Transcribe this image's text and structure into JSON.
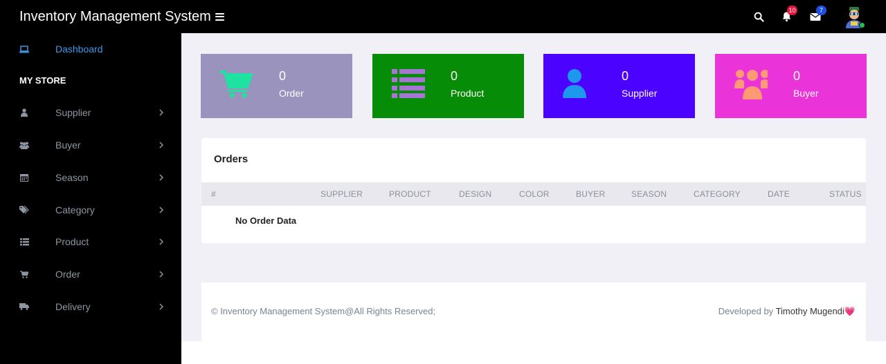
{
  "app": {
    "title": "Inventory Management System"
  },
  "topbar": {
    "notifications_count": "10",
    "messages_count": "7"
  },
  "sidebar": {
    "dashboard": "Dashboard",
    "section": "MY STORE",
    "items": [
      {
        "label": "Supplier",
        "icon": "user-icon"
      },
      {
        "label": "Buyer",
        "icon": "users-icon"
      },
      {
        "label": "Season",
        "icon": "calendar-icon"
      },
      {
        "label": "Category",
        "icon": "tags-icon"
      },
      {
        "label": "Product",
        "icon": "list-icon"
      },
      {
        "label": "Order",
        "icon": "cart-icon"
      },
      {
        "label": "Delivery",
        "icon": "truck-icon"
      }
    ]
  },
  "cards": [
    {
      "count": "0",
      "label": "Order",
      "color": "#9a93bd",
      "icon_color": "#1ee3a0"
    },
    {
      "count": "0",
      "label": "Product",
      "color": "#068c06",
      "icon_color": "#a874d6"
    },
    {
      "count": "0",
      "label": "Supplier",
      "color": "#4c02ff",
      "icon_color": "#1e97ee"
    },
    {
      "count": "0",
      "label": "Buyer",
      "color": "#ea33d9",
      "icon_color": "#fd9a74"
    }
  ],
  "orders": {
    "title": "Orders",
    "columns": [
      "#",
      "SUPPLIER",
      "PRODUCT",
      "DESIGN",
      "COLOR",
      "BUYER",
      "SEASON",
      "CATEGORY",
      "DATE",
      "STATUS"
    ],
    "empty_text": "No Order Data"
  },
  "footer": {
    "copyright": "© Inventory Management System@All Rights Reserved;",
    "developed_by": "Developed by",
    "developer": "Timothy Mugendi",
    "heart": "💗"
  }
}
